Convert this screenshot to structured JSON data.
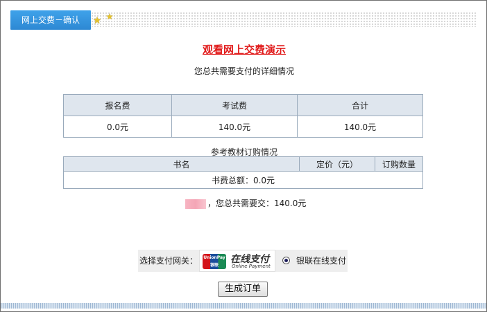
{
  "header": {
    "tab_label": "网上交费－确认",
    "icons": [
      "star-icon",
      "star-icon"
    ]
  },
  "demo_title": "观看网上交费演示",
  "subtitle": "您总共需要支付的详细情况",
  "fee_table": {
    "headers": [
      "报名费",
      "考试费",
      "合计"
    ],
    "values": [
      "0.0元",
      "140.0元",
      "140.0元"
    ]
  },
  "book_section": {
    "caption": "参考教材订购情况",
    "headers": [
      "书名",
      "定价（元）",
      "订购数量"
    ],
    "total": "书费总额：0.0元"
  },
  "summary": {
    "text": "，您总共需要交：140.0元"
  },
  "gateway": {
    "label": "选择支付网关：",
    "logo_cn": "在线支付",
    "logo_en": "Online Payment",
    "logo_mark_top": "UnionPay",
    "logo_mark_bottom": "银联",
    "option_label": "银联在线支付",
    "selected": true
  },
  "submit_label": "生成订单",
  "colors": {
    "tab_blue": "#2d88d3",
    "title_red": "#e11a1a",
    "table_header_bg": "#dfe6ee",
    "table_border": "#99aabb"
  }
}
